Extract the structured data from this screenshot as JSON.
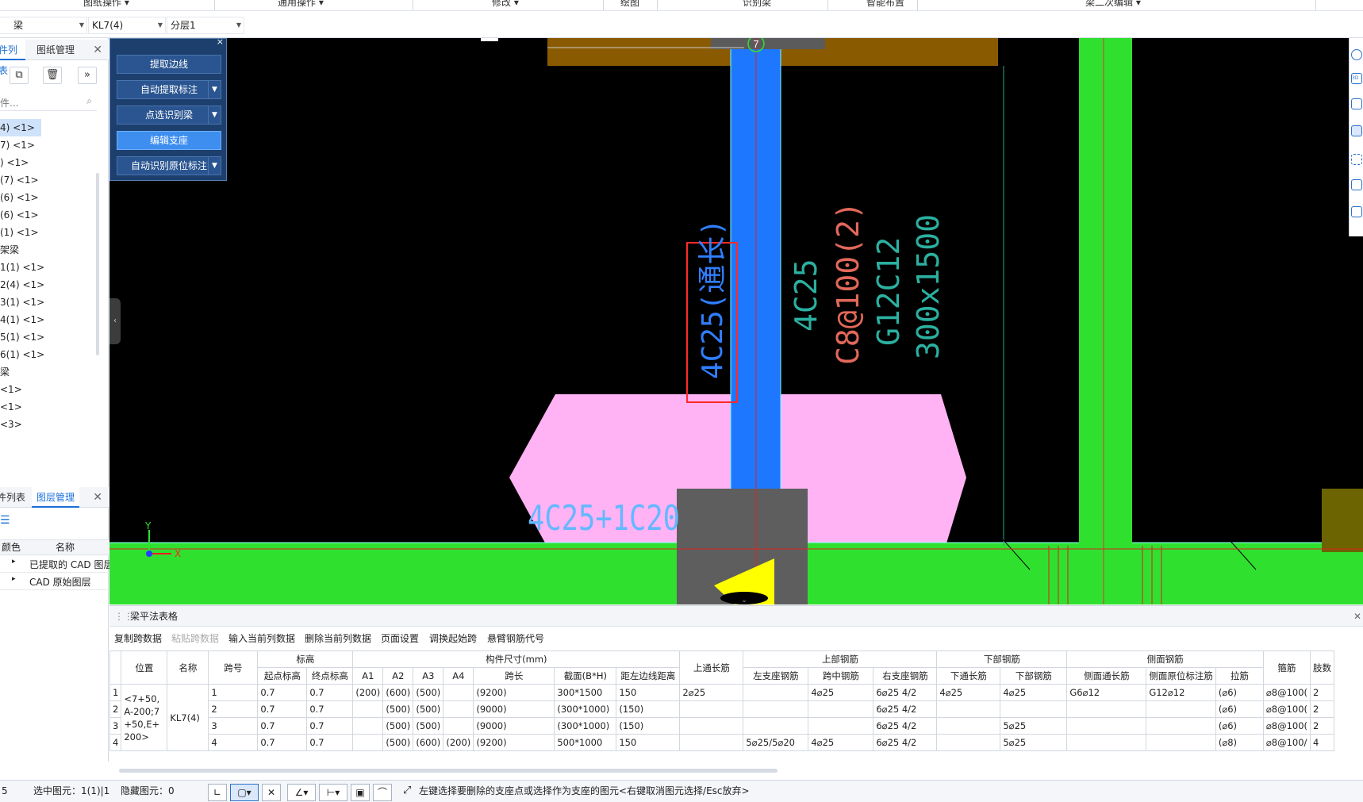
{
  "menu": {
    "items": [
      "图纸操作 ▾",
      "通用操作 ▾",
      "修改 ▾",
      "绘图",
      "识别梁",
      "智能布置",
      "梁二次编辑 ▾"
    ]
  },
  "selectors": {
    "category": "梁",
    "element": "KL7(4)",
    "layer": "分层1"
  },
  "left": {
    "tab_list": "件列表",
    "tab_drawings": "图纸管理",
    "search_placeholder": "件...",
    "tree": [
      "4) <1>",
      "7) <1>",
      ") <1>",
      "(7) <1>",
      "(6) <1>",
      "(6) <1>",
      "(1) <1>",
      "架梁",
      "1(1) <1>",
      "2(4) <1>",
      "3(1) <1>",
      "4(1) <1>",
      "5(1) <1>",
      "6(1) <1>",
      "梁",
      "<1>",
      "<1>",
      "<3>"
    ],
    "tab_list2": "件列表",
    "tab_layers": "图层管理",
    "layer_cols": {
      "color": "颜色",
      "name": "名称"
    },
    "layers": [
      "已提取的 CAD 图层",
      "CAD 原始图层"
    ]
  },
  "float_panel": {
    "buttons": [
      "提取边线",
      "自动提取标注",
      "点选识别梁",
      "编辑支座",
      "自动识别原位标注"
    ]
  },
  "canvas": {
    "axis_label": "7",
    "annot_red_box": "4C25(通长)",
    "annot_teal1": "4C25",
    "annot_red": "C8@100(2)",
    "annot_teal2": "G12C12",
    "annot_teal3": "300x1500",
    "annot_bottom": "4C25+1C20",
    "axis_y": "Y",
    "axis_x": "X"
  },
  "table_panel": {
    "title": "梁平法表格",
    "actions": [
      "复制跨数据",
      "粘贴跨数据",
      "输入当前列数据",
      "删除当前列数据",
      "页面设置",
      "调换起始跨",
      "悬臂钢筋代号"
    ],
    "group_headers": {
      "elev": "标高",
      "size": "构件尺寸(mm)",
      "top": "上部钢筋",
      "bottom": "下部钢筋",
      "side": "侧面钢筋"
    },
    "headers": {
      "pos": "位置",
      "name": "名称",
      "span": "跨号",
      "start_elev": "起点标高",
      "end_elev": "终点标高",
      "a1": "A1",
      "a2": "A2",
      "a3": "A3",
      "a4": "A4",
      "span_len": "跨长",
      "section": "截面(B*H)",
      "offset": "距左边线距离",
      "top_through": "上通长筋",
      "left_seat": "左支座钢筋",
      "mid": "跨中钢筋",
      "right_seat": "右支座钢筋",
      "bot_through": "下通长筋",
      "bot_bar": "下部钢筋",
      "side_through": "侧面通长筋",
      "side_orig": "侧面原位标注筋",
      "tie": "拉筋",
      "stirrup": "箍筋",
      "legs": "肢数"
    },
    "position_text": "<7+50,A-200;7+50,E+200>",
    "name_text": "KL7(4)",
    "rows": [
      {
        "idx": "1",
        "span": "1",
        "se": "0.7",
        "ee": "0.7",
        "a1": "(200)",
        "a2": "(600)",
        "a3": "(500)",
        "a4": "",
        "len": "(9200)",
        "sec": "300*1500",
        "off": "150",
        "tt": "2⌀25",
        "ls": "",
        "mid": "4⌀25",
        "rs": "6⌀25 4/2",
        "bt": "4⌀25",
        "bb": "4⌀25",
        "st": "G6⌀12",
        "so": "G12⌀12",
        "tie": "(⌀6)",
        "stir": "⌀8@100(",
        "legs": "2"
      },
      {
        "idx": "2",
        "span": "2",
        "se": "0.7",
        "ee": "0.7",
        "a1": "",
        "a2": "(500)",
        "a3": "(500)",
        "a4": "",
        "len": "(9000)",
        "sec": "(300*1000)",
        "off": "(150)",
        "tt": "",
        "ls": "",
        "mid": "",
        "rs": "6⌀25 4/2",
        "bt": "",
        "bb": "",
        "st": "",
        "so": "",
        "tie": "(⌀6)",
        "stir": "⌀8@100(",
        "legs": "2"
      },
      {
        "idx": "3",
        "span": "3",
        "se": "0.7",
        "ee": "0.7",
        "a1": "",
        "a2": "(500)",
        "a3": "(500)",
        "a4": "",
        "len": "(9000)",
        "sec": "(300*1000)",
        "off": "(150)",
        "tt": "",
        "ls": "",
        "mid": "",
        "rs": "6⌀25 4/2",
        "bt": "",
        "bb": "5⌀25",
        "st": "",
        "so": "",
        "tie": "(⌀6)",
        "stir": "⌀8@100(",
        "legs": "2"
      },
      {
        "idx": "4",
        "span": "4",
        "se": "0.7",
        "ee": "0.7",
        "a1": "",
        "a2": "(500)",
        "a3": "(600)",
        "a4": "(200)",
        "len": "(9200)",
        "sec": "500*1000",
        "off": "150",
        "tt": "",
        "ls": "5⌀25/5⌀20",
        "mid": "4⌀25",
        "rs": "6⌀25 4/2",
        "bt": "",
        "bb": "5⌀25",
        "st": "",
        "so": "",
        "tie": "(⌀8)",
        "stir": "⌀8@100/",
        "legs": "4"
      }
    ]
  },
  "status": {
    "left_num": "5",
    "selected": "选中图元：1(1)|1",
    "hidden": "隐藏图元：0",
    "hint": "左键选择要删除的支座点或选择作为支座的图元<右键取消图元选择/Esc放弃>"
  },
  "colors": {
    "canvas_bg": "#000000",
    "beam_blue": "#1e78ff",
    "green": "#2fe02f",
    "pink": "#ffb3f5",
    "brown": "#8a5a00",
    "accent": "#1a6fd8"
  }
}
